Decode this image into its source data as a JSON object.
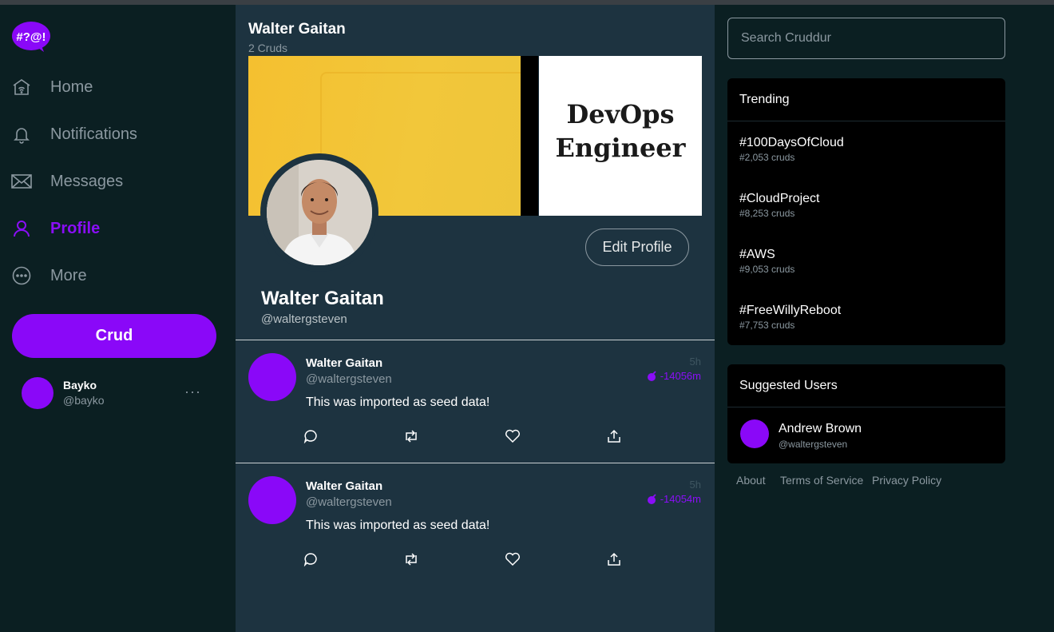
{
  "nav": {
    "logo_text": "#?@!",
    "items": [
      {
        "label": "Home",
        "icon": "home-icon",
        "active": false
      },
      {
        "label": "Notifications",
        "icon": "bell-icon",
        "active": false
      },
      {
        "label": "Messages",
        "icon": "envelope-icon",
        "active": false
      },
      {
        "label": "Profile",
        "icon": "user-icon",
        "active": true
      },
      {
        "label": "More",
        "icon": "more-circle-icon",
        "active": false
      }
    ],
    "crud_button": "Crud",
    "current_user": {
      "name": "Bayko",
      "handle": "@bayko",
      "more": "···"
    }
  },
  "main": {
    "title": "Walter Gaitan",
    "subtitle": "2 Cruds",
    "banner": {
      "line1": "DevOps",
      "line2": "Engineer"
    },
    "edit_profile": "Edit Profile",
    "profile_name": "Walter Gaitan",
    "profile_handle": "@waltergsteven",
    "cruds": [
      {
        "name": "Walter Gaitan",
        "handle": "@waltergsteven",
        "text": "This was imported as seed data!",
        "time": "5h",
        "expires": "-14056m"
      },
      {
        "name": "Walter Gaitan",
        "handle": "@waltergsteven",
        "text": "This was imported as seed data!",
        "time": "5h",
        "expires": "-14054m"
      }
    ]
  },
  "right": {
    "search_placeholder": "Search Cruddur",
    "trending_title": "Trending",
    "trending": [
      {
        "tag": "#100DaysOfCloud",
        "count": "#2,053 cruds"
      },
      {
        "tag": "#CloudProject",
        "count": "#8,253 cruds"
      },
      {
        "tag": "#AWS",
        "count": "#9,053 cruds"
      },
      {
        "tag": "#FreeWillyReboot",
        "count": "#7,753 cruds"
      }
    ],
    "suggested_title": "Suggested Users",
    "suggested": [
      {
        "name": "Andrew Brown",
        "handle": "@waltergsteven"
      }
    ],
    "footer": [
      "About",
      "Terms of Service",
      "Privacy Policy"
    ]
  },
  "colors": {
    "accent": "#8a08f8",
    "main_bg": "#1d3340",
    "side_bg": "#0b1f22",
    "panel_bg": "#000000"
  }
}
